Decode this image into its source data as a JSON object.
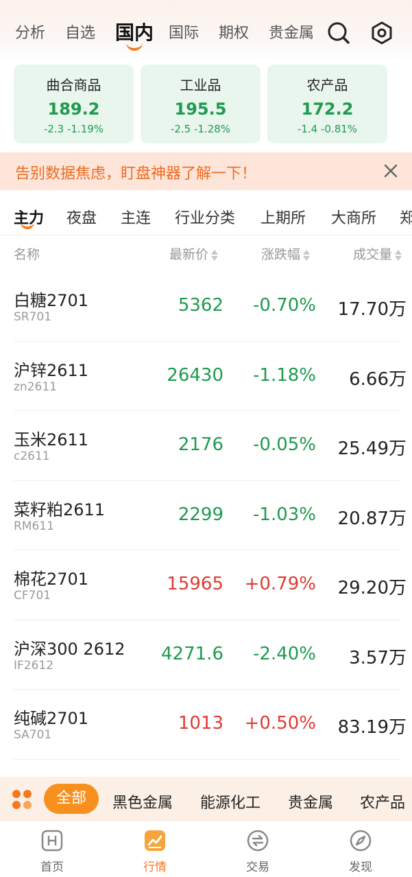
{
  "top_nav": {
    "tabs": [
      "分析",
      "自选",
      "国内",
      "国际",
      "期权",
      "贵金属"
    ],
    "active_index": 2,
    "search_icon": "search-icon",
    "settings_icon": "hexagon-settings-icon"
  },
  "index_cards": [
    {
      "name": "曲合商品",
      "value": "189.2",
      "change": "-2.3  -1.19%"
    },
    {
      "name": "工业品",
      "value": "195.5",
      "change": "-2.5  -1.28%"
    },
    {
      "name": "农产品",
      "value": "172.2",
      "change": "-1.4  -0.81%"
    }
  ],
  "banner": {
    "text": "告别数据焦虑，盯盘神器了解一下！",
    "close_icon": "close-icon"
  },
  "category_tabs": [
    "主力",
    "夜盘",
    "主连",
    "行业分类",
    "上期所",
    "大商所",
    "郑"
  ],
  "table_header": {
    "name": "名称",
    "price": "最新价",
    "change": "涨跌幅",
    "volume": "成交量"
  },
  "rows": [
    {
      "name": "白糖2701",
      "code": "SR701",
      "price": "5362",
      "change": "-0.70%",
      "volume": "17.70万",
      "direction": "down"
    },
    {
      "name": "沪锌2611",
      "code": "zn2611",
      "price": "26430",
      "change": "-1.18%",
      "volume": "6.66万",
      "direction": "down"
    },
    {
      "name": "玉米2611",
      "code": "c2611",
      "price": "2176",
      "change": "-0.05%",
      "volume": "25.49万",
      "direction": "down"
    },
    {
      "name": "菜籽粕2611",
      "code": "RM611",
      "price": "2299",
      "change": "-1.03%",
      "volume": "20.87万",
      "direction": "down"
    },
    {
      "name": "棉花2701",
      "code": "CF701",
      "price": "15965",
      "change": "+0.79%",
      "volume": "29.20万",
      "direction": "up"
    },
    {
      "name": "沪深300 2612",
      "code": "IF2612",
      "price": "4271.6",
      "change": "-2.40%",
      "volume": "3.57万",
      "direction": "down"
    },
    {
      "name": "纯碱2701",
      "code": "SA701",
      "price": "1013",
      "change": "+0.50%",
      "volume": "83.19万",
      "direction": "up"
    }
  ],
  "sector_bar": {
    "grid_icon": "grid-icon",
    "items": [
      "全部",
      "黑色金属",
      "能源化工",
      "贵金属",
      "农产品"
    ],
    "active_index": 0
  },
  "bottom_nav": {
    "items": [
      {
        "label": "首页",
        "icon": "home-h-icon"
      },
      {
        "label": "行情",
        "icon": "market-chart-icon"
      },
      {
        "label": "交易",
        "icon": "trade-exchange-icon"
      },
      {
        "label": "发现",
        "icon": "compass-icon"
      }
    ],
    "active_index": 1
  },
  "colors": {
    "accent": "#f47a1f",
    "down": "#1f9a4e",
    "up": "#e03a32",
    "card_bg": "#e9f6ee",
    "banner_bg": "#fde6d9"
  }
}
